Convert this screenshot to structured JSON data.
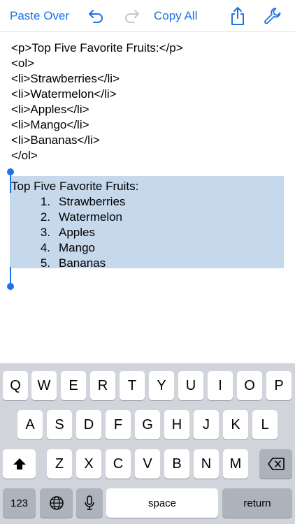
{
  "toolbar": {
    "paste_over": "Paste Over",
    "copy_all": "Copy All",
    "icons": {
      "undo": "undo-icon",
      "redo": "redo-icon",
      "share": "share-icon",
      "settings": "wrench-icon"
    }
  },
  "editor": {
    "code_lines": [
      "<p>Top Five Favorite Fruits:</p>",
      "<ol>",
      "<li>Strawberries</li>",
      "<li>Watermelon</li>",
      "<li>Apples</li>",
      "<li>Mango</li>",
      "<li>Bananas</li>",
      "</ol>"
    ],
    "rendered": {
      "title": "Top Five Favorite Fruits:",
      "items": [
        {
          "num": "1.",
          "text": "Strawberries"
        },
        {
          "num": "2.",
          "text": "Watermelon"
        },
        {
          "num": "3.",
          "text": "Apples"
        },
        {
          "num": "4.",
          "text": "Mango"
        },
        {
          "num": "5.",
          "text": "Bananas"
        }
      ]
    }
  },
  "keyboard": {
    "row1": [
      "Q",
      "W",
      "E",
      "R",
      "T",
      "Y",
      "U",
      "I",
      "O",
      "P"
    ],
    "row2": [
      "A",
      "S",
      "D",
      "F",
      "G",
      "H",
      "J",
      "K",
      "L"
    ],
    "row3": [
      "Z",
      "X",
      "C",
      "V",
      "B",
      "N",
      "M"
    ],
    "numbers": "123",
    "space": "space",
    "return": "return"
  },
  "colors": {
    "accent": "#1a73e8",
    "selection": "#c5d8ec",
    "keyboard_bg": "#d1d4da"
  }
}
